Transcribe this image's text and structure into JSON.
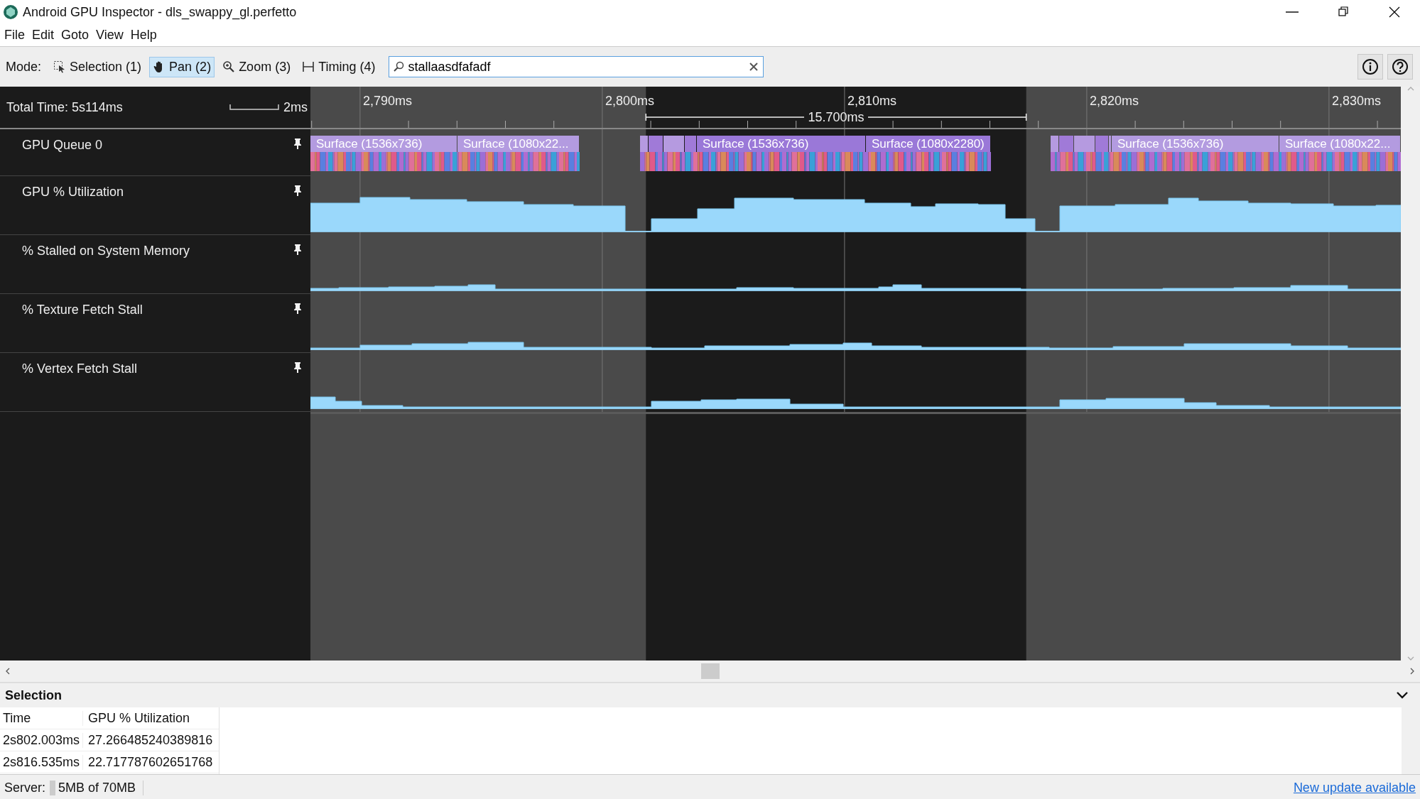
{
  "window": {
    "title": "Android GPU Inspector - dls_swappy_gl.perfetto"
  },
  "menu": [
    "File",
    "Edit",
    "Goto",
    "View",
    "Help"
  ],
  "toolbar": {
    "mode_label": "Mode:",
    "modes": [
      {
        "kind": "selection",
        "label": "Selection (1)",
        "selected": false
      },
      {
        "kind": "pan",
        "label": "Pan (2)",
        "selected": true
      },
      {
        "kind": "zoom",
        "label": "Zoom (3)",
        "selected": false
      },
      {
        "kind": "timing",
        "label": "Timing (4)",
        "selected": false
      }
    ],
    "search": {
      "value": "stallaasdfafadf"
    }
  },
  "ruler": {
    "total_time": "Total Time: 5s114ms",
    "scale": "2ms",
    "ticks": [
      "2,790ms",
      "2,800ms",
      "2,810ms",
      "2,820ms",
      "2,830ms"
    ],
    "selection_length": "15.700ms"
  },
  "tracks": [
    {
      "kind": "slices",
      "name": "GPU Queue 0",
      "slices": [
        "Surface (1536x736)",
        "Surface (1080x22...",
        "Surface (1536x736)",
        "Surface (1080x2280)",
        "Surface (1536x736)",
        "Surface (1080x22..."
      ]
    },
    {
      "kind": "counter",
      "name": "GPU % Utilization"
    },
    {
      "kind": "counter",
      "name": "% Stalled on System Memory"
    },
    {
      "kind": "counter",
      "name": "% Texture Fetch Stall"
    },
    {
      "kind": "counter",
      "name": "% Vertex Fetch Stall"
    }
  ],
  "selection_panel": {
    "title": "Selection",
    "columns": [
      "Time",
      "GPU % Utilization"
    ],
    "rows": [
      [
        "2s802.003ms",
        "27.266485240389816"
      ],
      [
        "2s816.535ms",
        "22.717787602651768"
      ]
    ]
  },
  "status_bar": {
    "label": "Server:",
    "memory": "5MB of 70MB",
    "link": "New update available"
  }
}
